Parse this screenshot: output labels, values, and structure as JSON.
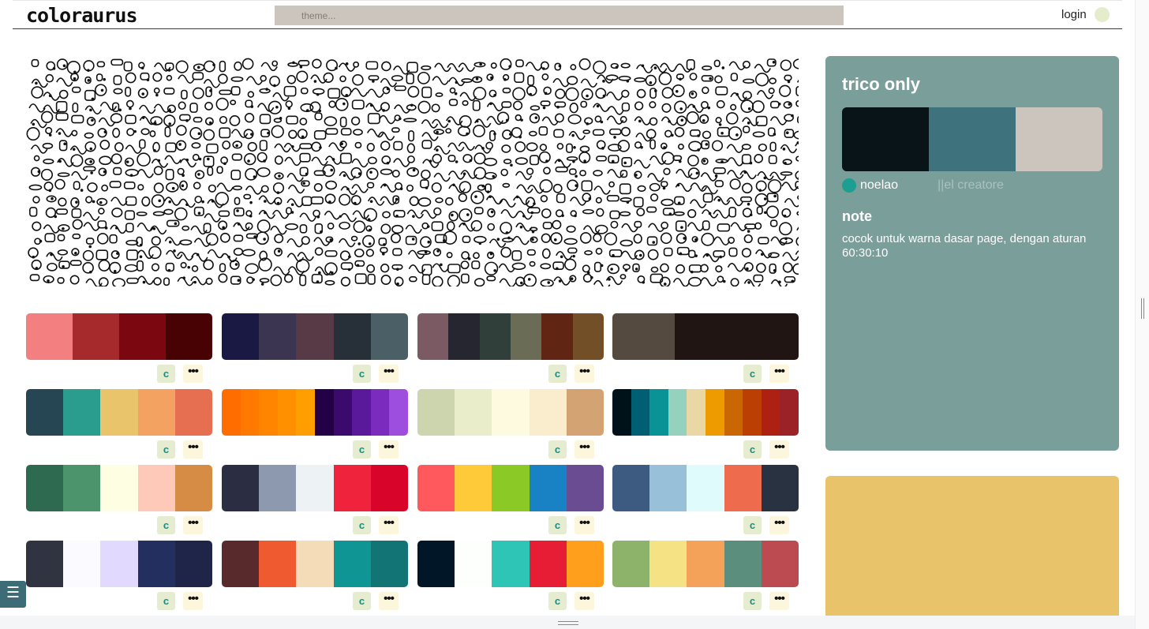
{
  "header": {
    "logo": "coloraurus",
    "search_placeholder": "theme...",
    "login_label": "login"
  },
  "palettes": [
    {
      "colors": [
        "#f47f80",
        "#a62a2c",
        "#7b0710",
        "#480204"
      ]
    },
    {
      "colors": [
        "#191944",
        "#3c3551",
        "#573a45",
        "#272f39",
        "#4b5f67"
      ]
    },
    {
      "colors": [
        "#7b5a63",
        "#262630",
        "#313f3a",
        "#6b6c55",
        "#612514",
        "#734f27"
      ]
    },
    {
      "colors": [
        "#544a40",
        "#201512",
        "#201512"
      ]
    },
    {
      "colors": [
        "#264653",
        "#2a9d8f",
        "#e9c46a",
        "#f4a261",
        "#e76f51"
      ]
    },
    {
      "colors": [
        "#ff6d00",
        "#ff7900",
        "#ff8500",
        "#ff9100",
        "#ff9e00",
        "#240046",
        "#3c096c",
        "#5a189a",
        "#7b2cbf",
        "#9d4edd"
      ]
    },
    {
      "colors": [
        "#ccd5ae",
        "#e9edc9",
        "#fefae0",
        "#faedcd",
        "#d4a373"
      ]
    },
    {
      "colors": [
        "#001219",
        "#005f73",
        "#0a9396",
        "#94d2bd",
        "#e9d8a6",
        "#ee9b00",
        "#ca6702",
        "#bb3e03",
        "#ae2012",
        "#9b2226"
      ]
    },
    {
      "colors": [
        "#2d6a4f",
        "#4c956c",
        "#fefee3",
        "#ffc9b9",
        "#d68c45"
      ]
    },
    {
      "colors": [
        "#2b2d42",
        "#8d99ae",
        "#edf2f4",
        "#ef233c",
        "#d90429"
      ]
    },
    {
      "colors": [
        "#ff595e",
        "#ffca3a",
        "#8ac926",
        "#1982c4",
        "#6a4c93"
      ]
    },
    {
      "colors": [
        "#3d5a80",
        "#98c1d9",
        "#e0fbfc",
        "#ee6c4d",
        "#293241"
      ]
    },
    {
      "colors": [
        "#2f3440",
        "#fbfbff",
        "#e2d9ff",
        "#23305f",
        "#1e2549"
      ]
    },
    {
      "colors": [
        "#582a2c",
        "#f05a30",
        "#f4dcb8",
        "#0e9594",
        "#127475"
      ]
    },
    {
      "colors": [
        "#011627",
        "#fdfffc",
        "#2ec4b6",
        "#e71d36",
        "#ff9f1c"
      ]
    },
    {
      "colors": [
        "#8cb369",
        "#f4e285",
        "#f4a259",
        "#5b8e7d",
        "#bc4b51"
      ]
    }
  ],
  "buttons": {
    "copy_label": "c",
    "more_label": "•••"
  },
  "detail": {
    "title": "trico only",
    "colors": [
      "#081418",
      "#3e737d",
      "#ccc5be"
    ],
    "creator_name": "noelao",
    "creator_role": "||el creatore",
    "note_title": "note",
    "note_text": "cocok untuk warna dasar page, dengan aturan 60:30:10",
    "card_color": "#7a9e9a"
  },
  "next_card_color": "#e8c36a",
  "menu_icon": "☰"
}
